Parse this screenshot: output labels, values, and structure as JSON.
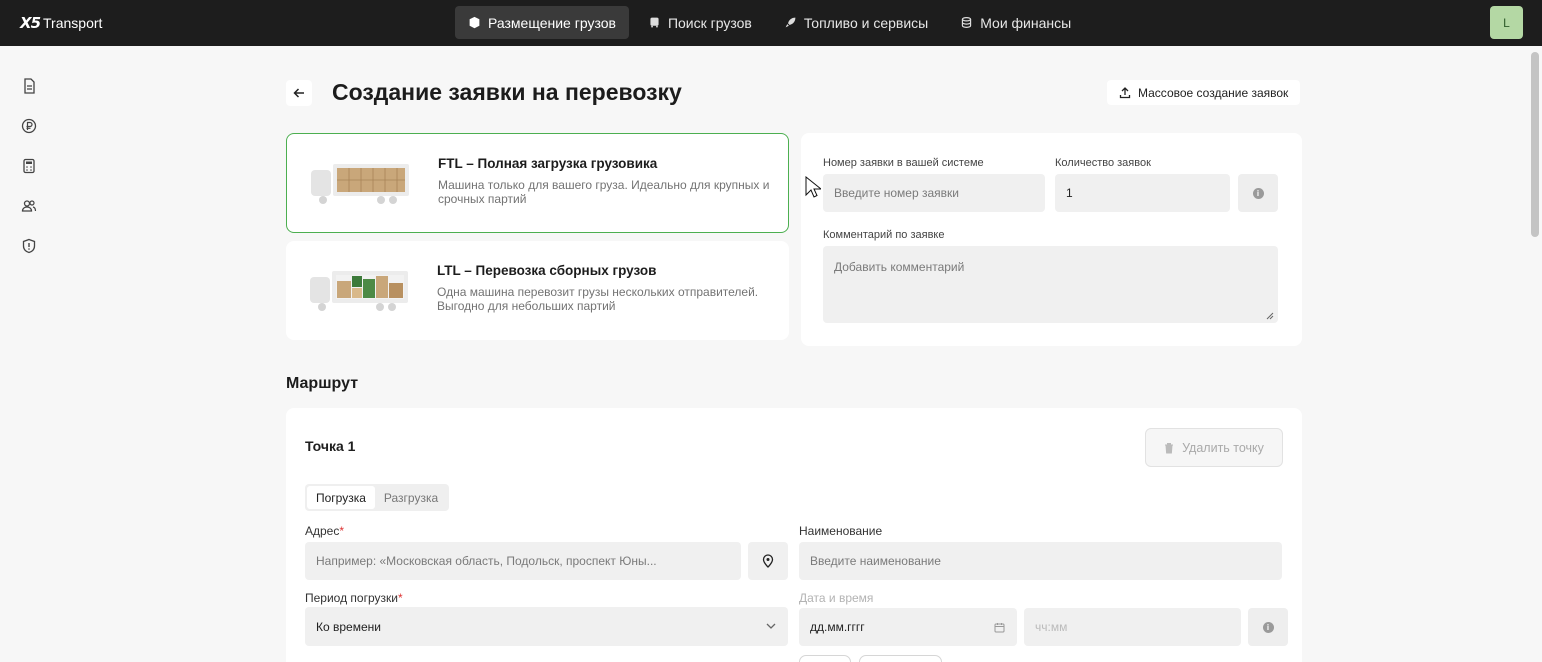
{
  "app": {
    "logo_mark": "X5",
    "logo_text": "Transport"
  },
  "nav": [
    {
      "label": "Размещение грузов",
      "icon": "box-icon",
      "active": true
    },
    {
      "label": "Поиск грузов",
      "icon": "truck-icon",
      "active": false
    },
    {
      "label": "Топливо и сервисы",
      "icon": "rocket-icon",
      "active": false
    },
    {
      "label": "Мои финансы",
      "icon": "database-icon",
      "active": false
    }
  ],
  "user": {
    "initial": "L"
  },
  "sidebar": [
    "document-icon",
    "ruble-icon",
    "calculator-icon",
    "users-icon",
    "shield-icon"
  ],
  "header": {
    "title": "Создание заявки на перевозку",
    "bulk_button": "Массовое создание заявок"
  },
  "types": [
    {
      "title": "FTL – Полная загрузка грузовика",
      "description": "Машина только для вашего груза. Идеально для крупных и срочных партий",
      "selected": true
    },
    {
      "title": "LTL – Перевозка сборных грузов",
      "description": "Одна машина перевозит грузы нескольких отправителей. Выгодно для небольших партий",
      "selected": false
    }
  ],
  "request": {
    "number_label": "Номер заявки в вашей системе",
    "number_placeholder": "Введите номер заявки",
    "count_label": "Количество заявок",
    "count_value": "1",
    "comment_label": "Комментарий по заявке",
    "comment_placeholder": "Добавить комментарий"
  },
  "route": {
    "section_title": "Маршрут",
    "point_title": "Точка 1",
    "delete_button": "Удалить точку",
    "tabs": [
      {
        "label": "Погрузка",
        "active": true
      },
      {
        "label": "Разгрузка",
        "active": false
      }
    ],
    "address_label": "Адрес",
    "address_placeholder": "Например: «Московская область, Подольск, проспект Юны...",
    "name_label": "Наименование",
    "name_placeholder": "Введите наименование",
    "period_label": "Период погрузки",
    "period_value": "Ко времени",
    "datetime_label": "Дата и время",
    "date_placeholder": "дд.мм.гггг",
    "time_placeholder": "чч:мм",
    "required_mark": "*"
  },
  "colors": {
    "topbar": "#1d1d1d",
    "accent_green": "#4caf50",
    "avatar": "#b4d8a4"
  }
}
